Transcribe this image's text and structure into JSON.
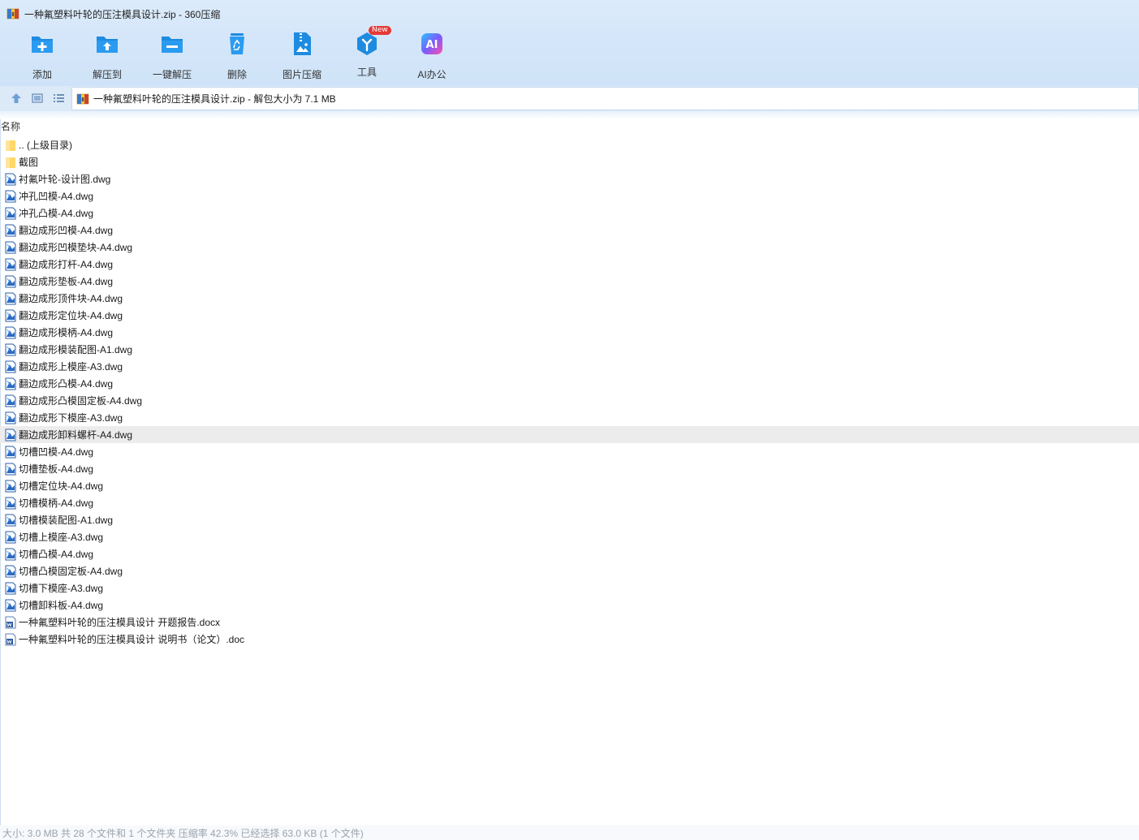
{
  "window": {
    "title": "一种氟塑料叶轮的压注模具设计.zip - 360压缩"
  },
  "toolbar": {
    "items": [
      {
        "label": "添加",
        "icon": "add-folder-icon"
      },
      {
        "label": "解压到",
        "icon": "extract-to-icon"
      },
      {
        "label": "一键解压",
        "icon": "one-click-extract-icon"
      },
      {
        "label": "删除",
        "icon": "recycle-bin-icon"
      },
      {
        "label": "图片压缩",
        "icon": "image-compress-icon"
      },
      {
        "label": "工具",
        "icon": "tools-icon",
        "badge": "New"
      },
      {
        "label": "AI办公",
        "icon": "ai-office-icon",
        "icon_text": "AI"
      }
    ]
  },
  "address": {
    "path": "一种氟塑料叶轮的压注模具设计.zip - 解包大小为 7.1 MB"
  },
  "list": {
    "column_name": "名称",
    "files": [
      {
        "name": ".. (上级目录)",
        "type": "folder"
      },
      {
        "name": "截图",
        "type": "folder"
      },
      {
        "name": "衬氟叶轮-设计图.dwg",
        "type": "dwg"
      },
      {
        "name": "冲孔凹模-A4.dwg",
        "type": "dwg"
      },
      {
        "name": "冲孔凸模-A4.dwg",
        "type": "dwg"
      },
      {
        "name": "翻边成形凹模-A4.dwg",
        "type": "dwg"
      },
      {
        "name": "翻边成形凹模垫块-A4.dwg",
        "type": "dwg"
      },
      {
        "name": "翻边成形打杆-A4.dwg",
        "type": "dwg"
      },
      {
        "name": "翻边成形垫板-A4.dwg",
        "type": "dwg"
      },
      {
        "name": "翻边成形顶件块-A4.dwg",
        "type": "dwg"
      },
      {
        "name": "翻边成形定位块-A4.dwg",
        "type": "dwg"
      },
      {
        "name": "翻边成形模柄-A4.dwg",
        "type": "dwg"
      },
      {
        "name": "翻边成形模装配图-A1.dwg",
        "type": "dwg"
      },
      {
        "name": "翻边成形上模座-A3.dwg",
        "type": "dwg"
      },
      {
        "name": "翻边成形凸模-A4.dwg",
        "type": "dwg"
      },
      {
        "name": "翻边成形凸模固定板-A4.dwg",
        "type": "dwg"
      },
      {
        "name": "翻边成形下模座-A3.dwg",
        "type": "dwg"
      },
      {
        "name": "翻边成形卸料螺杆-A4.dwg",
        "type": "dwg",
        "selected": true
      },
      {
        "name": "切槽凹模-A4.dwg",
        "type": "dwg"
      },
      {
        "name": "切槽垫板-A4.dwg",
        "type": "dwg"
      },
      {
        "name": "切槽定位块-A4.dwg",
        "type": "dwg"
      },
      {
        "name": "切槽模柄-A4.dwg",
        "type": "dwg"
      },
      {
        "name": "切槽模装配图-A1.dwg",
        "type": "dwg"
      },
      {
        "name": "切槽上模座-A3.dwg",
        "type": "dwg"
      },
      {
        "name": "切槽凸模-A4.dwg",
        "type": "dwg"
      },
      {
        "name": "切槽凸模固定板-A4.dwg",
        "type": "dwg"
      },
      {
        "name": "切槽下模座-A3.dwg",
        "type": "dwg"
      },
      {
        "name": "切槽卸料板-A4.dwg",
        "type": "dwg"
      },
      {
        "name": "一种氟塑料叶轮的压注模具设计 开题报告.docx",
        "type": "word"
      },
      {
        "name": "一种氟塑料叶轮的压注模具设计 说明书（论文）.doc",
        "type": "word"
      }
    ]
  },
  "status": {
    "text": "大小: 3.0 MB 共 28 个文件和 1 个文件夹 压缩率 42.3% 已经选择 63.0 KB (1 个文件)"
  },
  "colors": {
    "toolbar_bg": "#d6e7fa",
    "icon_blue": "#1e8be0",
    "selected_row": "#ececec",
    "badge_red": "#e53935"
  }
}
